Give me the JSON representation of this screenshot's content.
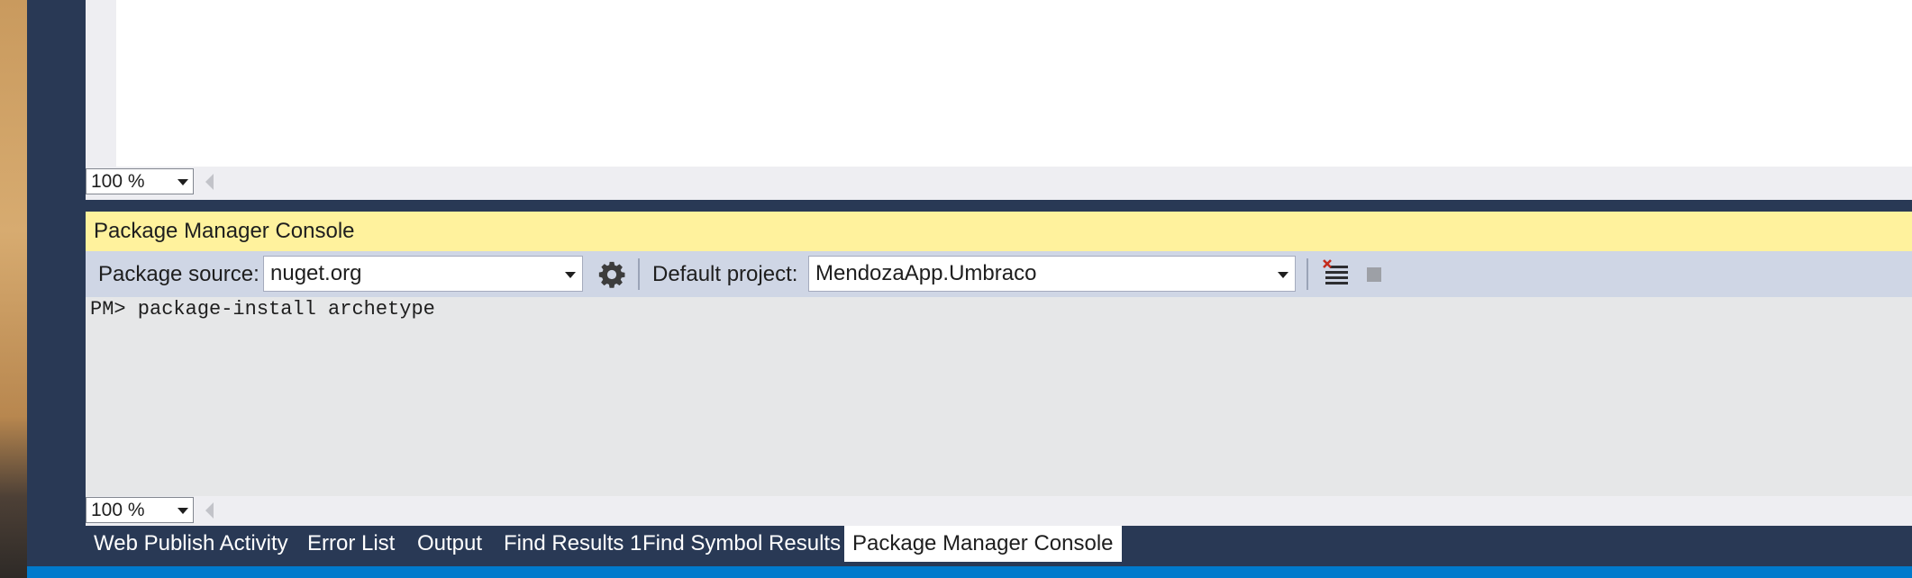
{
  "editor": {
    "zoom": "100 %"
  },
  "package_manager_console": {
    "title": "Package Manager Console",
    "toolbar": {
      "package_source_label": "Package source:",
      "package_source_value": "nuget.org",
      "settings_icon": "gear-icon",
      "default_project_label": "Default project:",
      "default_project_value": "MendozaApp.Umbraco",
      "clear_icon": "clear-console-icon",
      "stop_icon": "stop-icon"
    },
    "console_lines": [
      "PM> package-install archetype"
    ],
    "zoom": "100 %"
  },
  "bottom_tabs": [
    {
      "label": "Web Publish Activity",
      "active": false
    },
    {
      "label": "Error List",
      "active": false
    },
    {
      "label": "Output",
      "active": false
    },
    {
      "label": "Find Results 1",
      "active": false
    },
    {
      "label": "Find Symbol Results",
      "active": false
    },
    {
      "label": "Package Manager Console",
      "active": true
    }
  ],
  "colors": {
    "frame": "#293955",
    "tool_title": "#fff29d",
    "toolbar": "#cfd6e5",
    "console_bg": "#e6e7e8",
    "status_bar": "#007acc"
  }
}
